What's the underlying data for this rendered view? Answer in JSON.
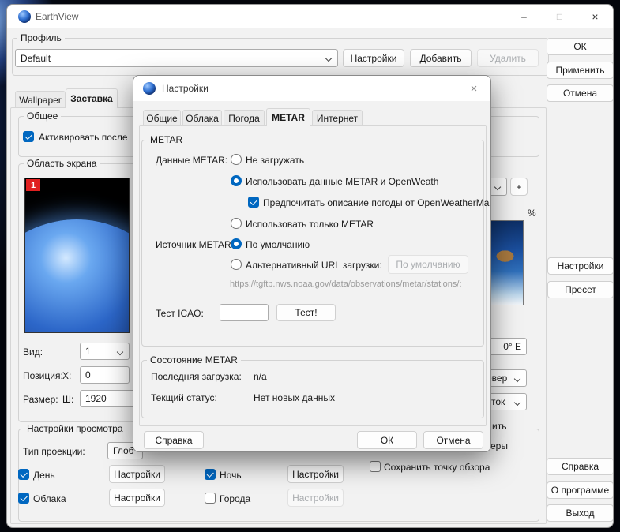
{
  "window": {
    "title": "EarthView",
    "controls": {
      "minimize": "–",
      "maximize": "□",
      "close": "×"
    },
    "profile": {
      "group_label": "Профиль",
      "combo_value": "Default",
      "settings": "Настройки",
      "add": "Добавить",
      "remove": "Удалить"
    },
    "side": {
      "ok": "ОК",
      "apply": "Применить",
      "cancel": "Отмена",
      "settings": "Настройки",
      "preset": "Пресет",
      "help": "Справка",
      "about": "О программе",
      "exit": "Выход"
    },
    "tabs": {
      "wallpaper": "Wallpaper",
      "screensaver": "Заставка"
    },
    "general": {
      "group_label": "Общее",
      "activate_after": "Активировать после"
    },
    "screen_area": {
      "group_label": "Область экрана",
      "monitor_badge": "1",
      "view_label": "Вид:",
      "view_value": "1",
      "position_label": "Позиция:",
      "x_label": "X:",
      "x_value": "0",
      "size_label": "Размер:",
      "width_label": "Ш:",
      "width_value": "1920"
    },
    "view_settings": {
      "group_label": "Настройки просмотра",
      "projection_label": "Тип проекции:",
      "projection_value": "Глоб",
      "day": "День",
      "night": "Ночь",
      "clouds": "Облака",
      "cities": "Города",
      "settings": "Настройки"
    },
    "fragments": {
      "plus": "+",
      "percent": "%",
      "coordinate": "0° E",
      "north_partial": "евер",
      "east_partial": "сток",
      "text_partial_1": "ить",
      "text_partial_2": "еры",
      "save_viewpoint": "Сохранить точку обзора"
    }
  },
  "dialog": {
    "title": "Настройки",
    "close": "×",
    "tabs": [
      "Общие",
      "Облака",
      "Погода",
      "METAR",
      "Интернет"
    ],
    "metar": {
      "group_label": "METAR",
      "data_label": "Данные METAR:",
      "opt_no_download": "Не загружать",
      "opt_use_both": "Использовать данные METAR и OpenWeath",
      "prefer_owm": "Предпочитать описание погоды от OpenWeatherMap",
      "opt_only_metar": "Использовать только METAR",
      "source_label": "Источник METAR:",
      "opt_default_source": "По умолчанию",
      "opt_alt_url": "Альтернативный URL загрузки:",
      "default_button": "По умолчанию",
      "url_hint": "https://tgftp.nws.noaa.gov/data/observations/metar/stations/:",
      "test_label": "Тест ICAO:",
      "icao_value": "",
      "test_button": "Тест!"
    },
    "status": {
      "group_label": "Сосотояние METAR",
      "last_load_label": "Последняя загрузка:",
      "last_load_value": "n/a",
      "current_status_label": "Текщий статус:",
      "current_status_value": "Нет новых данных"
    },
    "buttons": {
      "help": "Справка",
      "ok": "ОК",
      "cancel": "Отмена"
    }
  }
}
